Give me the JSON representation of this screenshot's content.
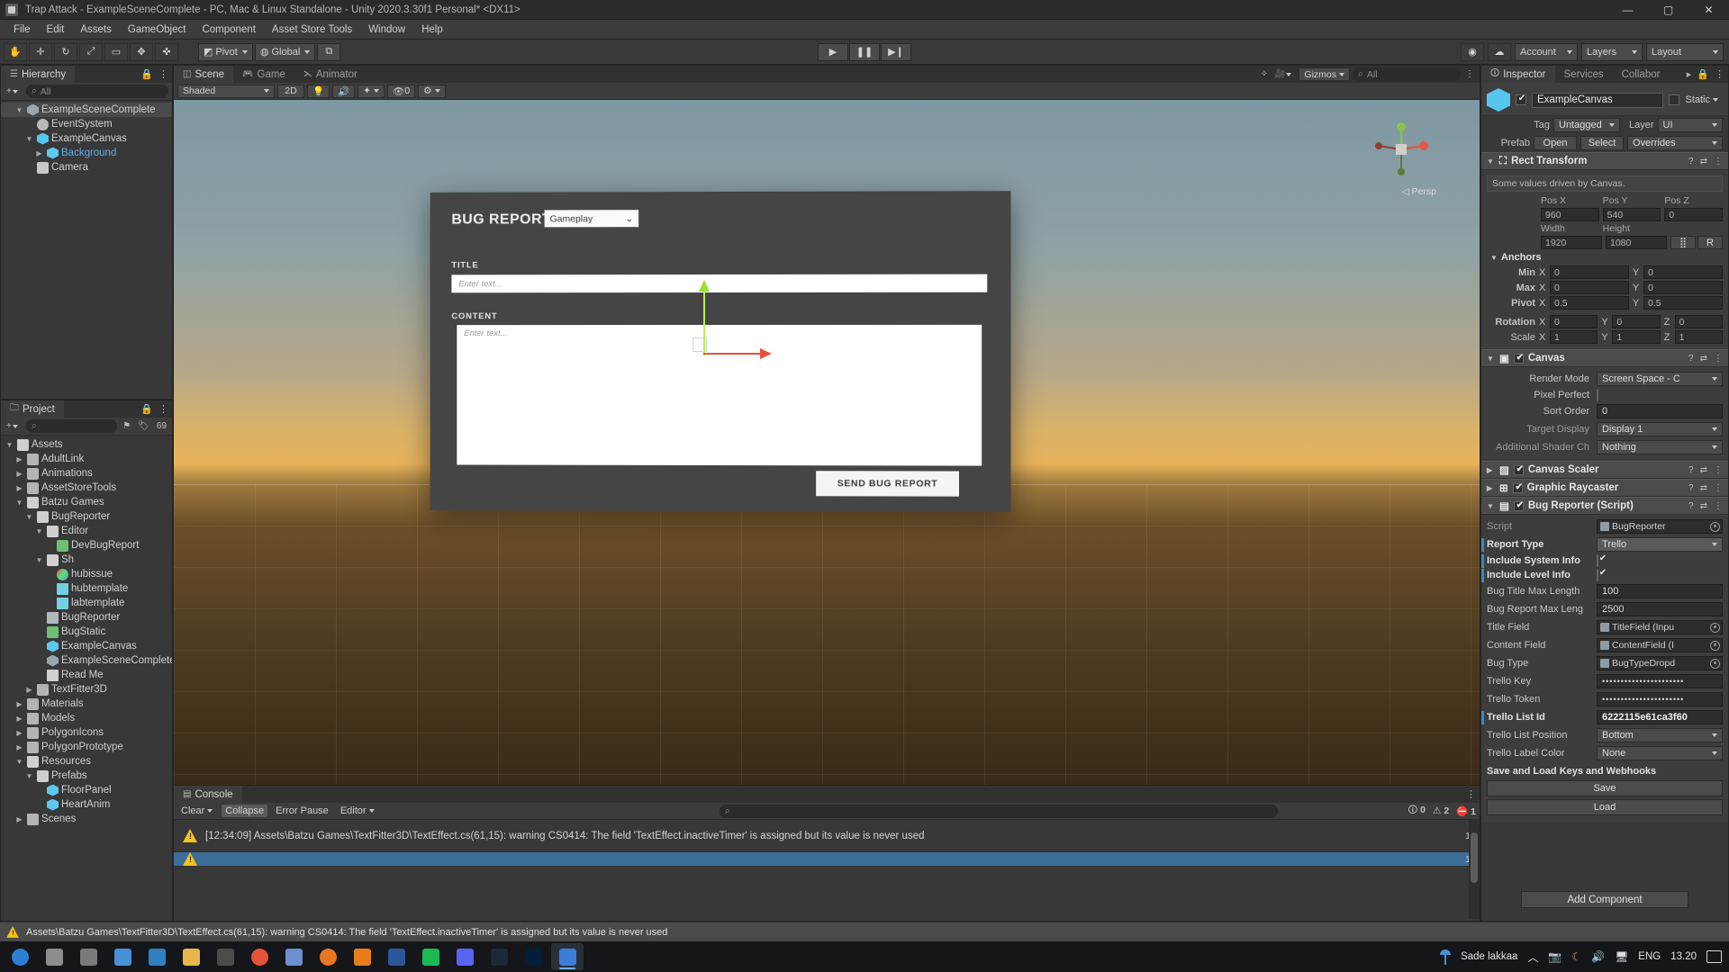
{
  "window": {
    "title": "Trap Attack - ExampleSceneComplete - PC, Mac & Linux Standalone - Unity 2020.3.30f1 Personal* <DX11>",
    "minimize": "—",
    "maximize": "▢",
    "close": "✕"
  },
  "menubar": {
    "items": [
      "File",
      "Edit",
      "Assets",
      "GameObject",
      "Component",
      "Asset Store Tools",
      "Window",
      "Help"
    ]
  },
  "toolbar": {
    "pivot": "Pivot",
    "global": "Global",
    "collab_icon": "collab-icon",
    "play": "▶",
    "pause": "❚❚",
    "step": "▶❙",
    "cloud": "cloud-icon",
    "services": "services-icon",
    "account": "Account",
    "layers": "Layers",
    "layout": "Layout"
  },
  "hierarchy": {
    "tab": "Hierarchy",
    "search_placeholder": "All",
    "add_label": "+",
    "items": [
      {
        "label": "ExampleSceneComplete",
        "depth": 1,
        "arrow": "▼",
        "icon": "scene-icon",
        "selected": true,
        "blue": false
      },
      {
        "label": "EventSystem",
        "depth": 2,
        "arrow": "",
        "icon": "event-icon",
        "selected": false,
        "blue": false
      },
      {
        "label": "ExampleCanvas",
        "depth": 2,
        "arrow": "▼",
        "icon": "canvas-icon",
        "selected": false,
        "blue": false
      },
      {
        "label": "Background",
        "depth": 3,
        "arrow": "▶",
        "icon": "cube-icon",
        "selected": false,
        "blue": true
      },
      {
        "label": "Camera",
        "depth": 2,
        "arrow": "",
        "icon": "camera-icon",
        "selected": false,
        "blue": false
      }
    ]
  },
  "project": {
    "tab": "Project",
    "search_placeholder": "",
    "count_badge": "69",
    "items": [
      {
        "label": "Assets",
        "depth": 0,
        "arrow": "▼",
        "icon": "folder-open-icon"
      },
      {
        "label": "AdultLink",
        "depth": 1,
        "arrow": "▶",
        "icon": "folder-icon"
      },
      {
        "label": "Animations",
        "depth": 1,
        "arrow": "▶",
        "icon": "folder-icon"
      },
      {
        "label": "AssetStoreTools",
        "depth": 1,
        "arrow": "▶",
        "icon": "folder-icon"
      },
      {
        "label": "Batzu Games",
        "depth": 1,
        "arrow": "▼",
        "icon": "folder-open-icon"
      },
      {
        "label": "BugReporter",
        "depth": 2,
        "arrow": "▼",
        "icon": "folder-open-icon"
      },
      {
        "label": "Editor",
        "depth": 3,
        "arrow": "▼",
        "icon": "folder-open-icon"
      },
      {
        "label": "DevBugReport",
        "depth": 4,
        "arrow": "",
        "icon": "script-icon"
      },
      {
        "label": "Sh",
        "depth": 3,
        "arrow": "▼",
        "icon": "folder-open-icon"
      },
      {
        "label": "hubissue",
        "depth": 4,
        "arrow": "",
        "icon": "material-icon"
      },
      {
        "label": "hubtemplate",
        "depth": 4,
        "arrow": "",
        "icon": "image-icon"
      },
      {
        "label": "labtemplate",
        "depth": 4,
        "arrow": "",
        "icon": "image-icon"
      },
      {
        "label": "BugReporter",
        "depth": 3,
        "arrow": "",
        "icon": "text-icon"
      },
      {
        "label": "BugStatic",
        "depth": 3,
        "arrow": "",
        "icon": "script-icon"
      },
      {
        "label": "ExampleCanvas",
        "depth": 3,
        "arrow": "",
        "icon": "prefab-icon"
      },
      {
        "label": "ExampleSceneComplete",
        "depth": 3,
        "arrow": "",
        "icon": "scene-icon"
      },
      {
        "label": "Read Me",
        "depth": 3,
        "arrow": "",
        "icon": "doc-icon"
      },
      {
        "label": "TextFitter3D",
        "depth": 2,
        "arrow": "▶",
        "icon": "folder-icon"
      },
      {
        "label": "Materials",
        "depth": 1,
        "arrow": "▶",
        "icon": "folder-icon"
      },
      {
        "label": "Models",
        "depth": 1,
        "arrow": "▶",
        "icon": "folder-icon"
      },
      {
        "label": "PolygonIcons",
        "depth": 1,
        "arrow": "▶",
        "icon": "folder-icon"
      },
      {
        "label": "PolygonPrototype",
        "depth": 1,
        "arrow": "▶",
        "icon": "folder-icon"
      },
      {
        "label": "Resources",
        "depth": 1,
        "arrow": "▼",
        "icon": "folder-open-icon"
      },
      {
        "label": "Prefabs",
        "depth": 2,
        "arrow": "▼",
        "icon": "folder-open-icon"
      },
      {
        "label": "FloorPanel",
        "depth": 3,
        "arrow": "",
        "icon": "prefab-icon"
      },
      {
        "label": "HeartAnim",
        "depth": 3,
        "arrow": "",
        "icon": "prefab-icon"
      },
      {
        "label": "Scenes",
        "depth": 1,
        "arrow": "▶",
        "icon": "folder-icon"
      }
    ]
  },
  "scene": {
    "tabs": [
      {
        "label": "Scene",
        "icon": "scene-tab-icon",
        "active": true
      },
      {
        "label": "Game",
        "icon": "game-tab-icon",
        "active": false
      },
      {
        "label": "Animator",
        "icon": "animator-tab-icon",
        "active": false
      }
    ],
    "shading": "Shaded",
    "mode_2d": "2D",
    "lighting_icon": "lighting-icon",
    "audio_icon": "audio-icon",
    "fx_icon": "effects-icon",
    "hidden_count": "0",
    "gizmos": "Gizmos",
    "search_placeholder": "All",
    "perspective_label": "Persp",
    "ui": {
      "header": "BUG REPORT",
      "bug_type_value": "Gameplay",
      "title_label": "TITLE",
      "title_placeholder": "Enter text...",
      "content_label": "CONTENT",
      "content_placeholder": "Enter text...",
      "send_button": "SEND BUG REPORT"
    }
  },
  "console": {
    "tab": "Console",
    "clear": "Clear",
    "collapse": "Collapse",
    "error_pause": "Error Pause",
    "editor": "Editor",
    "search_placeholder": "",
    "counts": {
      "info": "0",
      "warning": "2",
      "error": "1"
    },
    "rows": [
      {
        "text": "",
        "selected": true,
        "count": "1"
      },
      {
        "text": "[12:34:09] Assets\\Batzu Games\\TextFitter3D\\TextEffect.cs(61,15): warning CS0414: The field 'TextEffect.inactiveTimer' is assigned but its value is never used",
        "selected": false,
        "count": "1"
      }
    ]
  },
  "inspector": {
    "tabs": [
      {
        "label": "Inspector",
        "active": true
      },
      {
        "label": "Services",
        "active": false
      },
      {
        "label": "Collabor",
        "active": false
      }
    ],
    "object_name": "ExampleCanvas",
    "enabled": true,
    "static_label": "Static",
    "tag_label": "Tag",
    "tag_value": "Untagged",
    "layer_label": "Layer",
    "layer_value": "UI",
    "prefab_label": "Prefab",
    "prefab_open": "Open",
    "prefab_select": "Select",
    "prefab_overrides": "Overrides",
    "rect_transform": {
      "title": "Rect Transform",
      "helpbox": "Some values driven by Canvas.",
      "pos_headers": [
        "Pos X",
        "Pos Y",
        "Pos Z"
      ],
      "pos_values": [
        "960",
        "540",
        "0"
      ],
      "size_headers": [
        "Width",
        "Height"
      ],
      "size_values": [
        "1920",
        "1080"
      ],
      "blueprint_btn": "⣿",
      "raw_btn": "R",
      "anchors_label": "Anchors",
      "min_label": "Min",
      "min_x": "0",
      "min_y": "0",
      "max_label": "Max",
      "max_x": "0",
      "max_y": "0",
      "pivot_label": "Pivot",
      "pivot_x": "0.5",
      "pivot_y": "0.5",
      "rotation_label": "Rotation",
      "rot_x": "0",
      "rot_y": "0",
      "rot_z": "0",
      "scale_label": "Scale",
      "scale_x": "1",
      "scale_y": "1",
      "scale_z": "1"
    },
    "canvas": {
      "title": "Canvas",
      "render_mode_label": "Render Mode",
      "render_mode_value": "Screen Space - C",
      "pixel_perfect_label": "Pixel Perfect",
      "pixel_perfect": false,
      "sort_order_label": "Sort Order",
      "sort_order_value": "0",
      "target_display_label": "Target Display",
      "target_display_value": "Display 1",
      "shader_channels_label": "Additional Shader Ch",
      "shader_channels_value": "Nothing"
    },
    "canvas_scaler": {
      "title": "Canvas Scaler"
    },
    "graphic_raycaster": {
      "title": "Graphic Raycaster"
    },
    "bug_reporter": {
      "title": "Bug Reporter (Script)",
      "script_label": "Script",
      "script_value": "BugReporter",
      "report_type_label": "Report Type",
      "report_type_value": "Trello",
      "include_system_label": "Include System Info",
      "include_system": true,
      "include_level_label": "Include Level Info",
      "include_level": true,
      "title_max_label": "Bug Title Max Length",
      "title_max_value": "100",
      "report_max_label": "Bug Report Max Leng",
      "report_max_value": "2500",
      "title_field_label": "Title Field",
      "title_field_value": "TitleField (Inpu",
      "content_field_label": "Content Field",
      "content_field_value": "ContentField (I",
      "bug_type_label": "Bug Type",
      "bug_type_value": "BugTypeDropd",
      "trello_key_label": "Trello Key",
      "trello_key_value": "••••••••••••••••••••••",
      "trello_token_label": "Trello Token",
      "trello_token_value": "••••••••••••••••••••••",
      "trello_list_id_label": "Trello List Id",
      "trello_list_id_value": "6222115e61ca3f60",
      "trello_list_pos_label": "Trello List Position",
      "trello_list_pos_value": "Bottom",
      "trello_label_color_label": "Trello Label Color",
      "trello_label_color_value": "None",
      "save_load_label": "Save and Load Keys and Webhooks",
      "save_button": "Save",
      "load_button": "Load"
    },
    "add_component": "Add Component"
  },
  "statusbar": {
    "message": "Assets\\Batzu Games\\TextFitter3D\\TextEffect.cs(61,15): warning CS0414: The field 'TextEffect.inactiveTimer' is assigned but its value is never used"
  },
  "taskbar": {
    "weather": "Sade lakkaa",
    "language": "ENG",
    "time": "13.20",
    "chevron": "︿",
    "apps": [
      {
        "name": "start-button",
        "color": "#2b7fd4"
      },
      {
        "name": "search-button",
        "color": "#8d8d8d"
      },
      {
        "name": "task-view-button",
        "color": "#7a7a7a"
      },
      {
        "name": "widgets-button",
        "color": "#4a90d9"
      },
      {
        "name": "vscode-app",
        "color": "#2f7fc1"
      },
      {
        "name": "file-explorer-app",
        "color": "#e8b64c"
      },
      {
        "name": "unity-hub-app",
        "color": "#4b4b4b"
      },
      {
        "name": "chrome-app",
        "color": "#e5533d"
      },
      {
        "name": "paint-app",
        "color": "#6c8fd0"
      },
      {
        "name": "firefox-app",
        "color": "#e87722"
      },
      {
        "name": "blender-app",
        "color": "#e87d1e"
      },
      {
        "name": "word-app",
        "color": "#2b579a"
      },
      {
        "name": "spotify-app",
        "color": "#1db954"
      },
      {
        "name": "discord-app",
        "color": "#5865f2"
      },
      {
        "name": "steam-app",
        "color": "#1b2838"
      },
      {
        "name": "photoshop-app",
        "color": "#001e36"
      },
      {
        "name": "unity-editor-app",
        "color": "#3b7dd8"
      }
    ]
  }
}
